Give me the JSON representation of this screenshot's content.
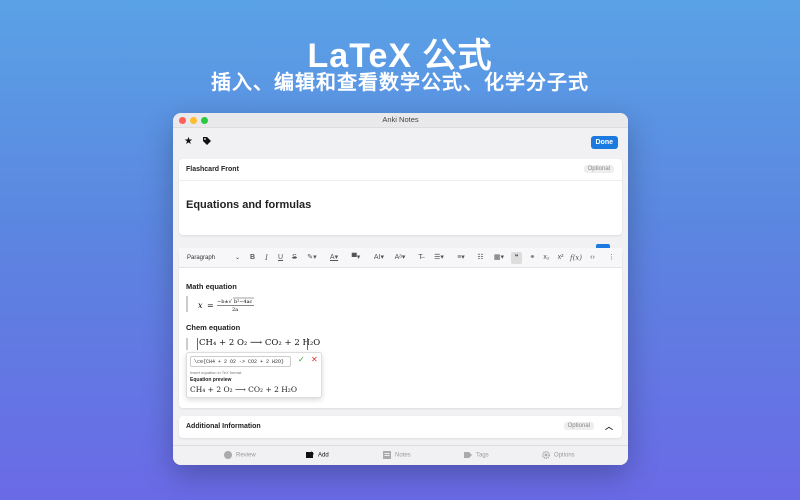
{
  "hero": {
    "title": "LaTeX 公式",
    "subtitle": "插入、编辑和查看数学公式、化学分子式"
  },
  "window": {
    "title": "Anki Notes",
    "done_label": "Done"
  },
  "front": {
    "label": "Flashcard Front",
    "optional": "Optional",
    "text": "Equations and formulas"
  },
  "editor": {
    "paragraph_select": "Paragraph",
    "math_heading": "Math equation",
    "chem_heading": "Chem equation",
    "chem_value": "CH₄ + 2 O₂ ⟶ CO₂ + 2 H₂O"
  },
  "latex_popup": {
    "input_value": "\\ce{CH4 + 2 O2 -> CO2 + 2 H2O}",
    "hint": "Insert equation in TeX format.",
    "preview_label": "Equation preview",
    "preview": "CH₄ + 2 O₂ ⟶ CO₂ + 2 H₂O"
  },
  "additional": {
    "label": "Additional Information",
    "optional": "Optional"
  },
  "tabs": [
    {
      "label": "Review",
      "icon": "review-icon",
      "active": false
    },
    {
      "label": "Add",
      "icon": "add-icon",
      "active": true
    },
    {
      "label": "Notes",
      "icon": "notes-icon",
      "active": false
    },
    {
      "label": "Tags",
      "icon": "tags-icon",
      "active": false
    },
    {
      "label": "Options",
      "icon": "options-icon",
      "active": false
    }
  ],
  "colors": {
    "accent": "#1a7ae0",
    "confirm": "#2aa336",
    "cancel": "#e03030"
  }
}
